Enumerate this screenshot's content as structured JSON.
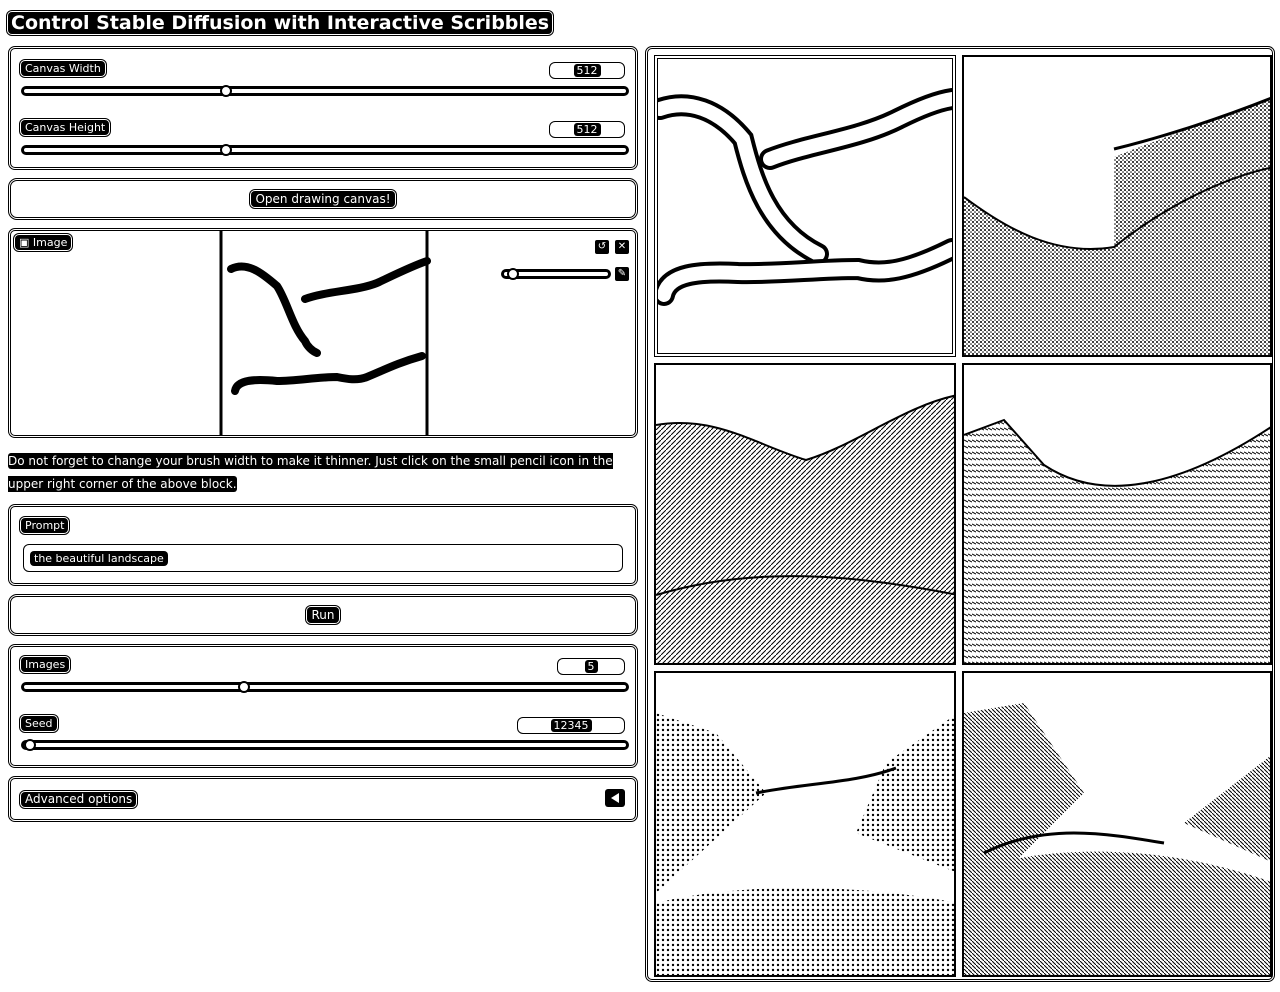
{
  "app": {
    "title": "Control Stable Diffusion with Interactive Scribbles"
  },
  "canvas_size": {
    "width_label": "Canvas Width",
    "width_value": "512",
    "width_fraction": 0.33,
    "height_label": "Canvas Height",
    "height_value": "512",
    "height_fraction": 0.33
  },
  "open_canvas_button": "Open drawing canvas!",
  "image_panel": {
    "label": "Image",
    "brush_fraction": 0.1
  },
  "note": "Do not forget to change your brush width to make it thinner. Just click on the small pencil icon in the upper right corner of the above block.",
  "prompt": {
    "label": "Prompt",
    "value": "the beautiful landscape"
  },
  "run_button": "Run",
  "images": {
    "label": "Images",
    "value": "5",
    "fraction": 0.36
  },
  "seed": {
    "label": "Seed",
    "value": "12345",
    "fraction": 0.0
  },
  "advanced": {
    "label": "Advanced options"
  },
  "icons": {
    "undo": "undo-icon",
    "clear": "close-icon",
    "brush": "pencil-icon",
    "expand": "triangle-left-icon",
    "image": "image-icon"
  },
  "gallery": [
    "scribble-input",
    "landscape-1",
    "landscape-2",
    "landscape-3",
    "landscape-4",
    "landscape-5"
  ]
}
